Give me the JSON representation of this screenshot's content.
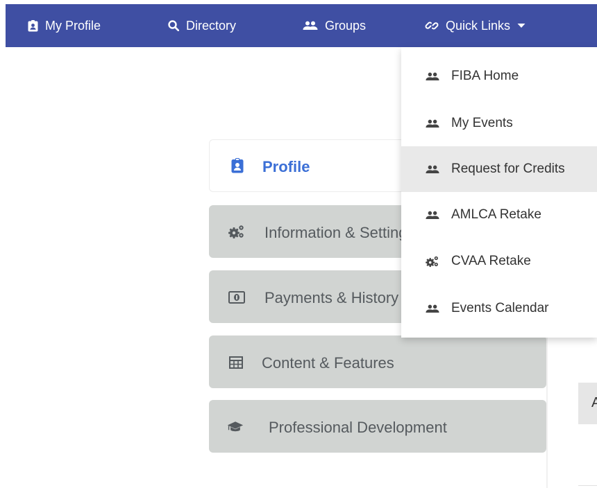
{
  "navbar": {
    "items": [
      {
        "label": "My Profile",
        "icon": "id-badge-icon"
      },
      {
        "label": "Directory",
        "icon": "search-icon"
      },
      {
        "label": "Groups",
        "icon": "group-icon"
      },
      {
        "label": "Quick Links",
        "icon": "link-icon",
        "caret": "caret-down-icon"
      }
    ],
    "background": "#3f4fa3"
  },
  "sidebar": {
    "items": [
      {
        "label": "Profile",
        "icon": "id-badge-icon",
        "active": true
      },
      {
        "label": "Information & Settings",
        "icon": "gears-icon"
      },
      {
        "label": "Payments & History",
        "icon": "money-bill-icon"
      },
      {
        "label": "Content & Features",
        "icon": "table-icon"
      },
      {
        "label": "Professional Development",
        "icon": "graduation-cap-icon"
      }
    ],
    "active_color": "#3b6fd6"
  },
  "dropdown": {
    "items": [
      {
        "label": "FIBA Home",
        "icon": "group-icon"
      },
      {
        "label": "My Events",
        "icon": "group-icon"
      },
      {
        "label": "Request for Credits",
        "icon": "group-icon",
        "hovered": true
      },
      {
        "label": "AMLCA Retake",
        "icon": "group-icon"
      },
      {
        "label": "CVAA Retake",
        "icon": "gears-icon"
      },
      {
        "label": "Events Calendar",
        "icon": "group-icon"
      }
    ]
  },
  "right_panel": {
    "header_initial": "A"
  }
}
